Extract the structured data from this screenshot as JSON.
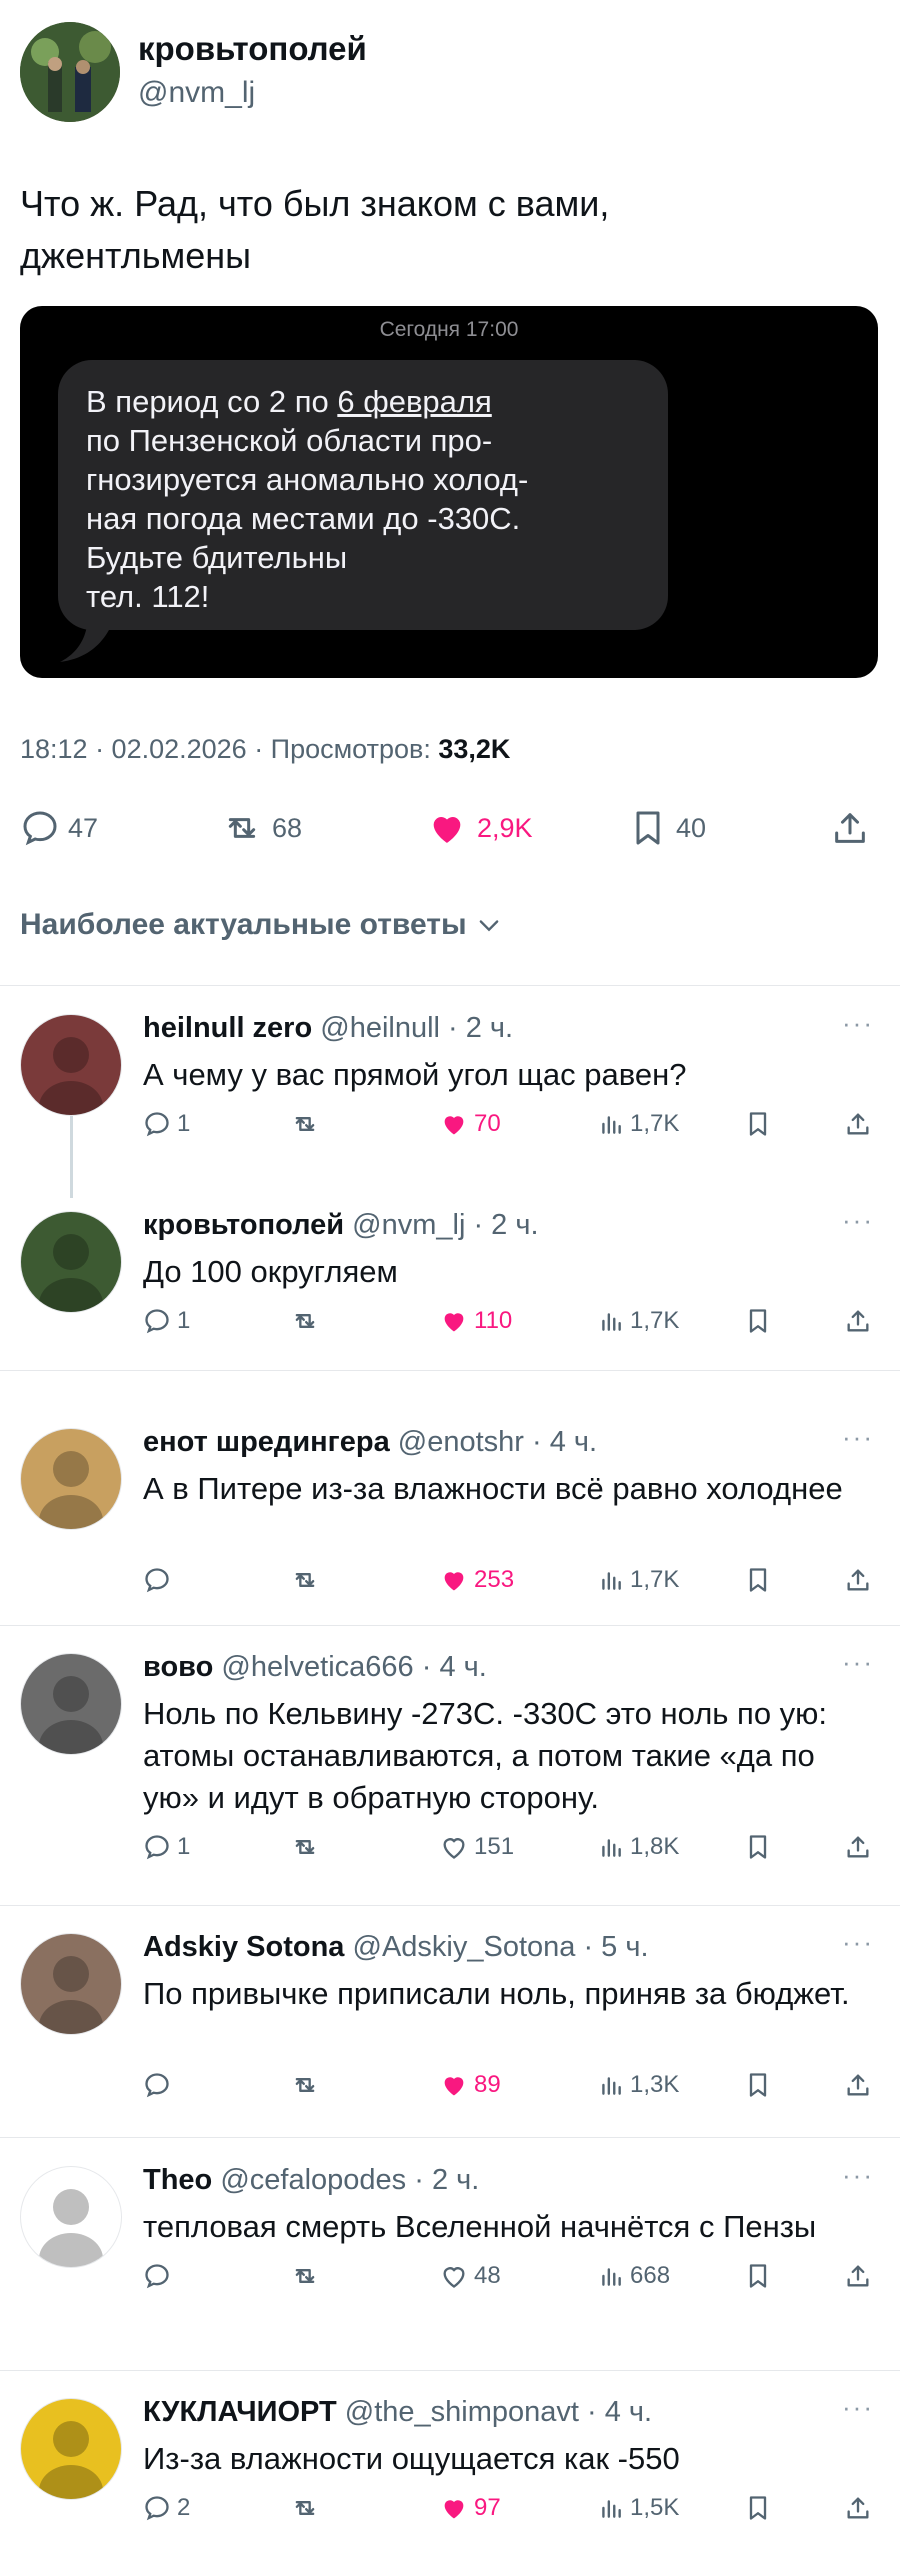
{
  "post": {
    "author_name": "кровьтополей",
    "author_handle": "@nvm_lj",
    "text_line1": "Что ж. Рад, что был знаком с вами,",
    "text_line2": "джентльмены",
    "sms": {
      "timestamp": "Сегодня 17:00",
      "lines": [
        "В период со 2 по 6 февраля",
        "по Пензенской области про-",
        "гнозируется аномально холод-",
        "ная погода местами до -330С.",
        "Будьте бдительны",
        "тел. 112!"
      ],
      "underlined": "6 февраля"
    },
    "meta_time": "18:12 · 02.02.2026 · Просмотров: ",
    "meta_views": "33,2K",
    "stats": {
      "replies": "47",
      "reposts": "68",
      "likes": "2,9K",
      "bookmarks": "40"
    }
  },
  "section_title": "Наиболее актуальные ответы",
  "replies": [
    {
      "name": "heilnull zero",
      "handle": "@heilnull · 2 ч.",
      "text": "А чему у вас прямой угол щас равен?",
      "reply_count": "1",
      "likes": "70",
      "liked": true,
      "views": "1,7K"
    },
    {
      "name": "кровьтополей",
      "handle": "@nvm_lj · 2 ч.",
      "text": "До 100 округляем",
      "reply_count": "1",
      "likes": "110",
      "liked": true,
      "views": "1,7K"
    },
    {
      "name": "енот шредингера",
      "handle": "@enotshr · 4 ч.",
      "text": "А в Питере из-за влажности всё равно холоднее",
      "reply_count": "",
      "likes": "253",
      "liked": true,
      "views": "1,7K"
    },
    {
      "name": "вово",
      "handle": "@helvetica666 · 4 ч.",
      "text": "Ноль по Кельвину -273С. -330С это ноль по    ую: атомы останавливаются, а потом такие «да по    ую» и идут в обратную сторону.",
      "reply_count": "1",
      "likes": "151",
      "liked": false,
      "views": "1,8K"
    },
    {
      "name": "Adskiy Sotona",
      "handle": "@Adskiy_Sotona · 5 ч.",
      "text": "По привычке приписали ноль, приняв за бюджет.",
      "reply_count": "",
      "likes": "89",
      "liked": true,
      "views": "1,3K"
    },
    {
      "name": "Theo",
      "handle": "@cefalopodes · 2 ч.",
      "text": "тепловая смерть Вселенной начнётся с Пензы",
      "reply_count": "",
      "likes": "48",
      "liked": false,
      "views": "668"
    },
    {
      "name": "КУКЛАЧИОРТ",
      "handle": "@the_shimponavt · 4 ч.",
      "text": "Из-за влажности ощущается как -550",
      "reply_count": "2",
      "likes": "97",
      "liked": true,
      "views": "1,5K"
    }
  ],
  "colors": {
    "like": "#f91880",
    "muted": "#536471",
    "sms_bg": "#000000",
    "bubble": "#262628",
    "accent": "#1d9bf0"
  },
  "icons": [
    "reply-icon",
    "repost-icon",
    "heart-icon",
    "bookmark-icon",
    "share-icon",
    "views-icon",
    "more-icon",
    "chevron-down-icon"
  ]
}
